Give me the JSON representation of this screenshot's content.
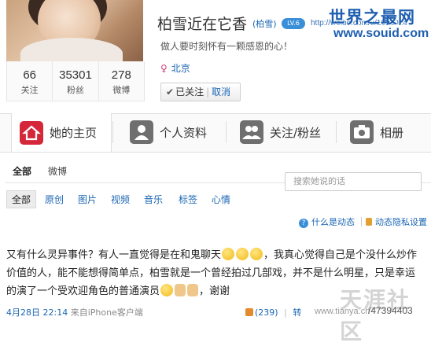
{
  "profile": {
    "name": "柏雪近在它香",
    "alias": "(柏雪)",
    "level_badge": "LV.6",
    "url_fragment": "http://weibo.com/u/1632024",
    "motto": "做人要时刻怀有一颗感恩的心！",
    "location": "北京",
    "follow_status": "已关注",
    "cancel_label": "取消"
  },
  "stats": [
    {
      "value": "66",
      "label": "关注"
    },
    {
      "value": "35301",
      "label": "粉丝"
    },
    {
      "value": "278",
      "label": "微博"
    }
  ],
  "tabs": [
    {
      "label": "她的主页",
      "icon": "home-icon"
    },
    {
      "label": "个人资料",
      "icon": "person-icon"
    },
    {
      "label": "关注/粉丝",
      "icon": "people-icon"
    },
    {
      "label": "相册",
      "icon": "camera-icon"
    }
  ],
  "subtabs": {
    "all": "全部",
    "weibo": "微博"
  },
  "search_placeholder": "搜索她说的话",
  "filters": [
    "全部",
    "原创",
    "图片",
    "视频",
    "音乐",
    "标签",
    "心情"
  ],
  "links": {
    "help": "什么是动态",
    "privacy": "动态隐私设置"
  },
  "post": {
    "text_part1": "又有什么灵异事件？有人一直觉得是在和鬼聊天",
    "text_part2": "，我真心觉得自己是个没什么炒作价值的人，能不能想得简单点，柏雪就是一个曾经拍过几部戏，并不是什么明星，只是幸运的演了一个受欢迎角色的普通演员",
    "text_part3": "，谢谢",
    "date": "4月28日 22:14",
    "source": "来自iPhone客户端",
    "like_count": "(239)",
    "forward": "转"
  },
  "watermarks": {
    "site_cn": "世界之最网",
    "site_url": "www.souid.com",
    "tianya": "天涯社区",
    "tianya_url": "www.tianya.cn",
    "post_id": "/47394403"
  },
  "colors": {
    "accent": "#d4283a",
    "link": "#1a66b3",
    "watermark": "#1f5fb0"
  }
}
